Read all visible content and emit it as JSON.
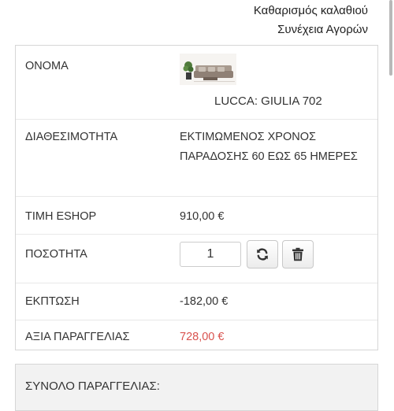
{
  "header": {
    "links": [
      "Καθαρισμός καλαθιού",
      "Συνέχεια Αγορών"
    ]
  },
  "cart": {
    "name_label": "ΟΝΟΜΑ",
    "product_name": "LUCCA: GIULIA 702",
    "product_image_icon": "sofa-product-thumbnail",
    "availability_label": "ΔΙΑΘΕΣΙΜΟΤΗΤΑ",
    "availability_value": "ΕΚΤΙΜΩΜΕΝΟΣ ΧΡΟΝΟΣ ΠΑΡΑΔΟΣΗΣ 60 ΕΩΣ 65 ΗΜΕΡΕΣ",
    "price_label": "ΤΙΜΗ ESHOP",
    "price_value": "910,00 €",
    "quantity_label": "ΠΟΣΟΤΗΤΑ",
    "quantity_value": "1",
    "refresh_icon": "refresh-icon",
    "delete_icon": "trash-icon",
    "discount_label": "ΕΚΠΤΩΣΗ",
    "discount_value": "-182,00 €",
    "order_value_label": "ΑΞΙΑ ΠΑΡΑΓΓΕΛΙΑΣ",
    "order_value": "728,00 €"
  },
  "summary": {
    "total_label": "ΣΥΝΟΛΟ ΠΑΡΑΓΓΕΛΙΑΣ:"
  },
  "colors": {
    "accent_red": "#d9534f",
    "border": "#d6d6d6",
    "text": "#333333"
  }
}
